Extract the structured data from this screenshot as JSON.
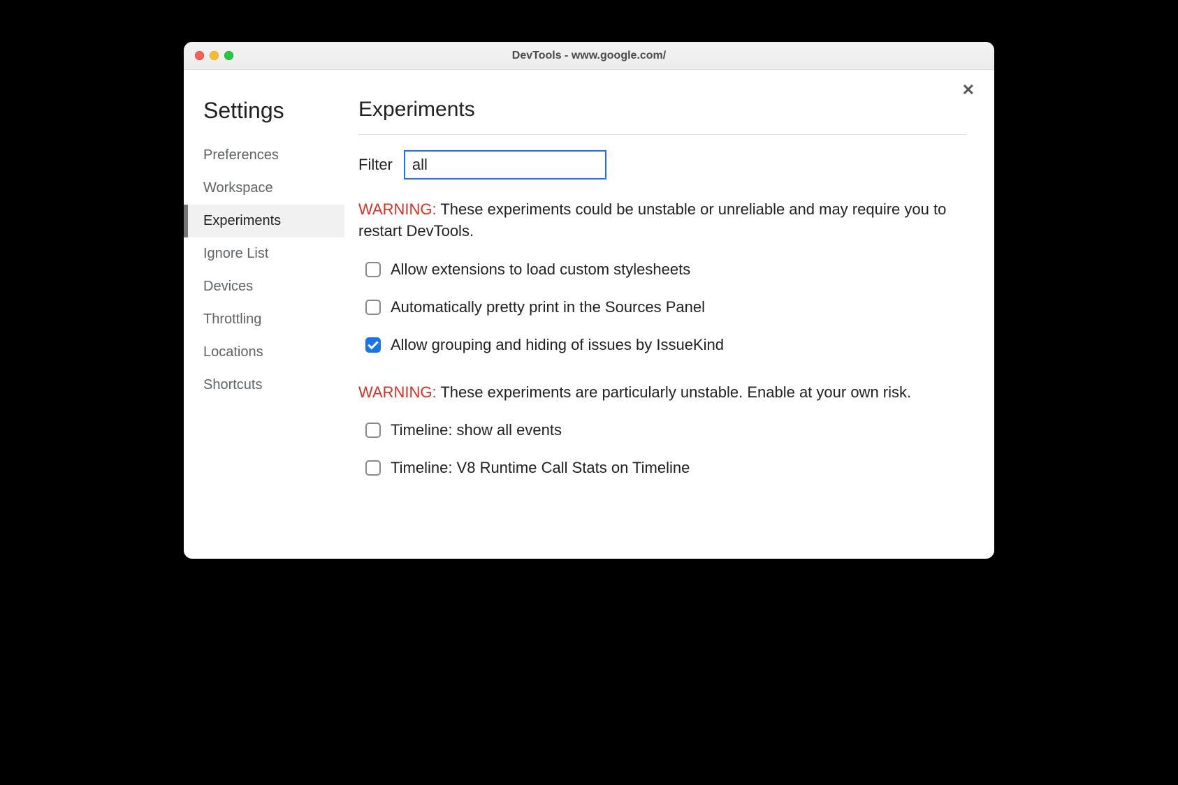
{
  "window": {
    "title": "DevTools - www.google.com/"
  },
  "sidebar": {
    "title": "Settings",
    "items": [
      {
        "label": "Preferences",
        "active": false
      },
      {
        "label": "Workspace",
        "active": false
      },
      {
        "label": "Experiments",
        "active": true
      },
      {
        "label": "Ignore List",
        "active": false
      },
      {
        "label": "Devices",
        "active": false
      },
      {
        "label": "Throttling",
        "active": false
      },
      {
        "label": "Locations",
        "active": false
      },
      {
        "label": "Shortcuts",
        "active": false
      }
    ]
  },
  "main": {
    "title": "Experiments",
    "filter_label": "Filter",
    "filter_value": "all",
    "warning1_label": "WARNING:",
    "warning1_text": " These experiments could be unstable or unreliable and may require you to restart DevTools.",
    "experiments_group1": [
      {
        "label": "Allow extensions to load custom stylesheets",
        "checked": false
      },
      {
        "label": "Automatically pretty print in the Sources Panel",
        "checked": false
      },
      {
        "label": "Allow grouping and hiding of issues by IssueKind",
        "checked": true
      }
    ],
    "warning2_label": "WARNING:",
    "warning2_text": " These experiments are particularly unstable. Enable at your own risk.",
    "experiments_group2": [
      {
        "label": "Timeline: show all events",
        "checked": false
      },
      {
        "label": "Timeline: V8 Runtime Call Stats on Timeline",
        "checked": false
      }
    ]
  }
}
